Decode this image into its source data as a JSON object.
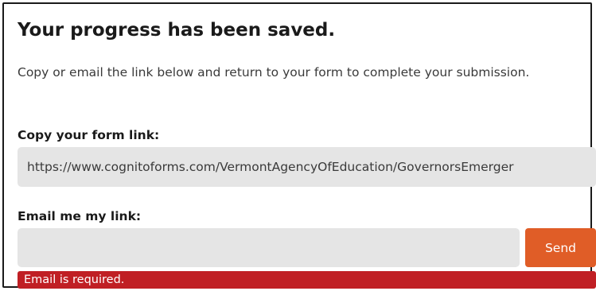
{
  "dialog": {
    "title": "Your progress has been saved.",
    "message": "Copy or email the link below and return to your form to complete your submission.",
    "copy_label": "Copy your form link:",
    "form_link": "https://www.cognitoforms.com/VermontAgencyOfEducation/GovernorsEmerger",
    "email_label": "Email me my link:",
    "email_value": "",
    "send_label": "Send",
    "error_text": "Email is required."
  },
  "colors": {
    "send_button": "#e05d27",
    "error_bar": "#c01f24",
    "field_background": "#e5e5e5"
  }
}
